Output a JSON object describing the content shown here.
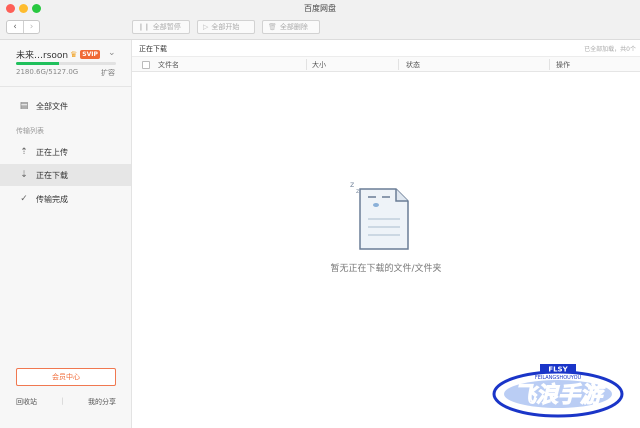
{
  "window": {
    "title": "百度网盘"
  },
  "toolbar": {
    "pause_all": "全部暂停",
    "start_all": "全部开始",
    "delete_all": "全部删除"
  },
  "user": {
    "name": "未来…rsoon",
    "badge": "SVIP",
    "quota": "2180.6G/5127.0G",
    "quota_fraction": 0.425,
    "expand": "扩容"
  },
  "sidebar": {
    "all_files": "全部文件",
    "section_label": "传输列表",
    "uploading": "正在上传",
    "downloading": "正在下载",
    "completed": "传输完成",
    "vip_center": "会员中心",
    "recycle_bin": "回收站",
    "my_share": "我的分享",
    "separator": "|"
  },
  "main": {
    "title": "正在下载",
    "status": "已全部加载，共0个",
    "columns": [
      "文件名",
      "大小",
      "状态",
      "操作"
    ],
    "empty_text": "暂无正在下载的文件/文件夹"
  },
  "overlay": {
    "logo_top": "FLSY",
    "logo_sub": "FEILANGSHOUYOU",
    "logo_main": "飞浪手游"
  },
  "colors": {
    "accent_green": "#20c05c",
    "vip_orange": "#f06a36",
    "logo_blue": "#1a35c8"
  }
}
